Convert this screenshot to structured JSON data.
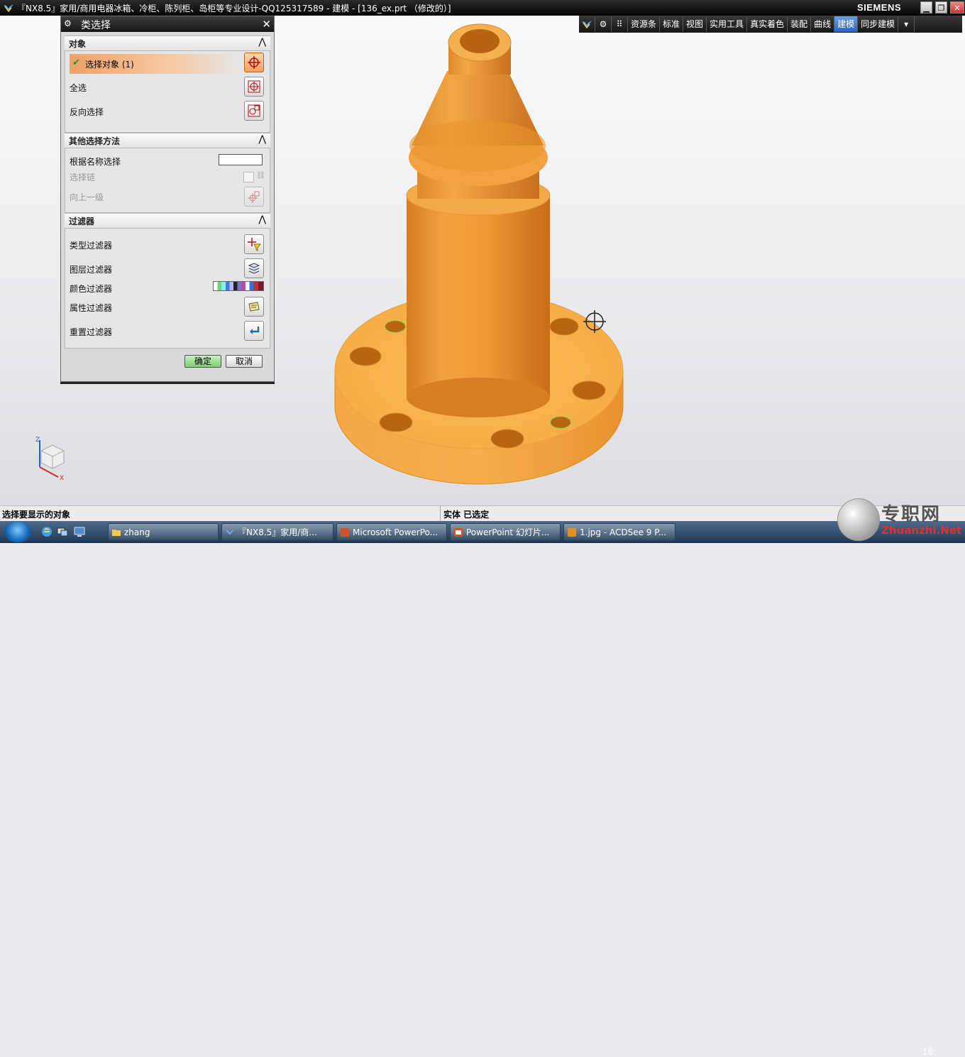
{
  "window": {
    "title": "『NX8.5』家用/商用电器冰箱、冷柜、陈列柜、岛柜等专业设计-QQ125317589 - 建模 - [136_ex.prt （修改的）]",
    "brand": "SIEMENS",
    "controls": [
      "minimize",
      "restore",
      "close"
    ]
  },
  "toolbar": {
    "icons": [
      "nx-icon",
      "gear-icon",
      "grid-icon"
    ],
    "tabs": [
      {
        "label": "资源条",
        "active": false
      },
      {
        "label": "标准",
        "active": false
      },
      {
        "label": "视图",
        "active": false
      },
      {
        "label": "实用工具",
        "active": false
      },
      {
        "label": "真实着色",
        "active": false
      },
      {
        "label": "装配",
        "active": false
      },
      {
        "label": "曲线",
        "active": false
      },
      {
        "label": "建模",
        "active": true
      },
      {
        "label": "同步建模",
        "active": false
      }
    ]
  },
  "dialog": {
    "title": "类选择",
    "groups": {
      "object": {
        "header": "对象",
        "select_object": "选择对象 (1)",
        "select_all": "全选",
        "invert_select": "反向选择"
      },
      "other": {
        "header": "其他选择方法",
        "select_by_name": "根据名称选择",
        "select_by_name_value": "",
        "select_chain": "选择链",
        "up_one_level": "向上一级"
      },
      "filters": {
        "header": "过滤器",
        "type_filter": "类型过滤器",
        "layer_filter": "图层过滤器",
        "color_filter": "颜色过滤器",
        "attribute_filter": "属性过滤器",
        "reset_filter": "重置过滤器"
      }
    },
    "ok": "确定",
    "cancel": "取消"
  },
  "statusbar": {
    "prompt": "选择要显示的对象",
    "status": "实体 已选定"
  },
  "triad": {
    "z": "Z",
    "x": "X"
  },
  "taskbar": {
    "tasks": [
      {
        "label": "zhang"
      },
      {
        "label": "『NX8.5』家用/商..."
      },
      {
        "label": "Microsoft PowerPo..."
      },
      {
        "label": "PowerPoint 幻灯片..."
      },
      {
        "label": "1.jpg - ACDSee 9 P..."
      }
    ],
    "clock": "18:"
  },
  "watermark": {
    "cn": "专职网",
    "en": "Zhuanzhi.Net"
  },
  "colors": {
    "model": "#f3a43a",
    "model_dark": "#c9731e",
    "selected_hole": "#38c838",
    "accent": "#2d65b8"
  }
}
